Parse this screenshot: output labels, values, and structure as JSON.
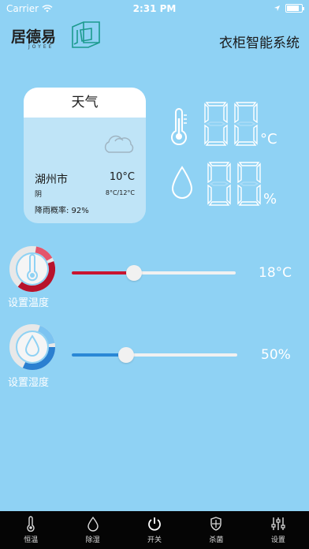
{
  "status_bar": {
    "carrier": "Carrier",
    "time": "2:31 PM",
    "battery_level": 0.85
  },
  "header": {
    "logo_text": "居德易",
    "logo_sub": "JOYEE",
    "title": "衣柜智能系统"
  },
  "weather": {
    "title": "天气",
    "icon": "cloud-icon",
    "city": "湖州市",
    "temperature": "10°C",
    "condition": "阴",
    "range": "8°C/12°C",
    "rain_chance": "降雨概率: 92%"
  },
  "readings": {
    "temperature": {
      "icon": "thermometer-icon",
      "digits": "00",
      "unit": "°C"
    },
    "humidity": {
      "icon": "droplet-icon",
      "digits": "00",
      "unit": "%"
    }
  },
  "controls": {
    "temperature": {
      "label": "设置温度",
      "value_text": "18°C",
      "slider_fraction": 0.38,
      "accent": "#c8142f"
    },
    "humidity": {
      "label": "设置湿度",
      "value_text": "50%",
      "slider_fraction": 0.33,
      "accent": "#2a88d6"
    }
  },
  "tabs": [
    {
      "label": "恒温",
      "icon": "thermometer-icon"
    },
    {
      "label": "除湿",
      "icon": "droplet-icon"
    },
    {
      "label": "开关",
      "icon": "power-icon"
    },
    {
      "label": "杀菌",
      "icon": "shield-icon"
    },
    {
      "label": "设置",
      "icon": "sliders-icon"
    }
  ]
}
